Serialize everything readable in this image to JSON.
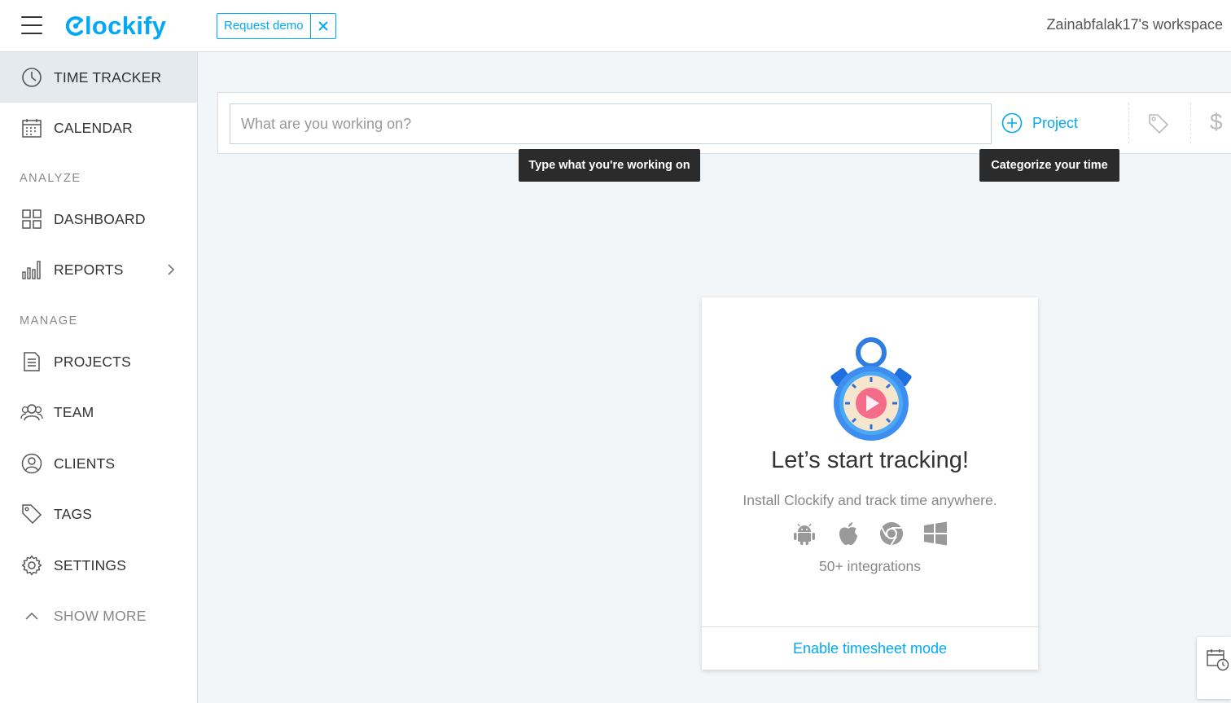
{
  "topbar": {
    "logo_text": "lockify",
    "request_demo_label": "Request demo",
    "workspace_label": "Zainabfalak17's workspace"
  },
  "sidebar": {
    "items": [
      {
        "label": "TIME TRACKER",
        "icon": "clock-icon",
        "active": true
      },
      {
        "label": "CALENDAR",
        "icon": "calendar-icon"
      },
      {
        "label": "DASHBOARD",
        "icon": "dashboard-icon"
      },
      {
        "label": "REPORTS",
        "icon": "bar-chart-icon"
      },
      {
        "label": "PROJECTS",
        "icon": "document-icon"
      },
      {
        "label": "TEAM",
        "icon": "team-icon"
      },
      {
        "label": "CLIENTS",
        "icon": "user-circle-icon"
      },
      {
        "label": "TAGS",
        "icon": "tag-icon"
      },
      {
        "label": "SETTINGS",
        "icon": "gear-icon"
      }
    ],
    "section_analyze": "ANALYZE",
    "section_manage": "MANAGE",
    "show_more_label": "SHOW MORE"
  },
  "tracker": {
    "placeholder": "What are you working on?",
    "project_label": "Project"
  },
  "tooltips": {
    "input_tip": "Type what you're working on",
    "project_tip": "Categorize your time"
  },
  "card": {
    "title": "Let’s start tracking!",
    "subtitle": "Install Clockify and track time anywhere.",
    "integrations": "50+ integrations",
    "platforms": [
      "android-icon",
      "apple-icon",
      "chrome-icon",
      "windows-icon"
    ],
    "footer_link": "Enable timesheet mode"
  },
  "colors": {
    "accent": "#03a9f4",
    "sidebar_active": "#e4eaee",
    "background": "#f2f6f8",
    "tooltip_bg": "#2b2b2b"
  }
}
